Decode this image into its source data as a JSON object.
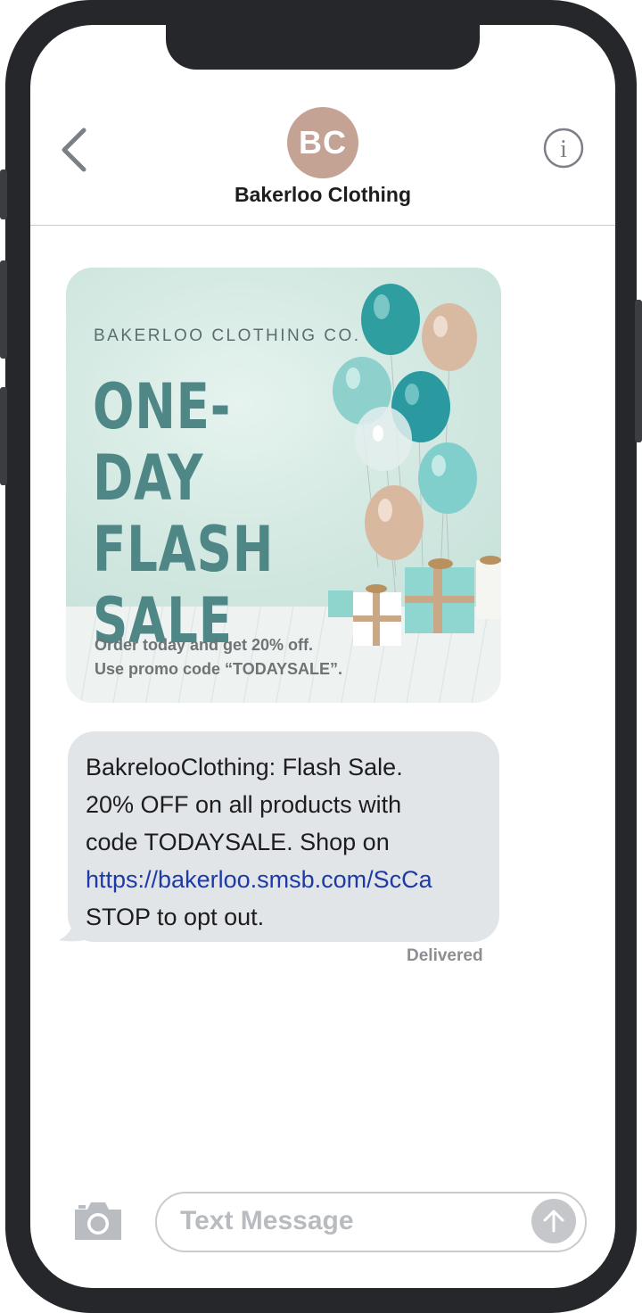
{
  "header": {
    "avatar_initials": "BC",
    "contact_name": "Bakerloo Clothing",
    "back_icon": "chevron-left-icon",
    "info_icon": "info-icon"
  },
  "promo_image": {
    "brand": "BAKERLOO CLOTHING CO.",
    "headline_line1": "ONE-DAY",
    "headline_line2": "FLASH",
    "headline_line3": "SALE",
    "note_line1": "Order today and get 20% off.",
    "note_line2": "Use promo code “TODAYSALE”."
  },
  "message": {
    "line1": "BakrelooClothing: Flash Sale.",
    "line2": "20% OFF on all products with",
    "line3": "code TODAYSALE. Shop on",
    "link": "https://bakerloo.smsb.com/ScCa",
    "line5": "STOP to opt out.",
    "status": "Delivered"
  },
  "composer": {
    "placeholder": "Text Message",
    "camera_icon": "camera-icon",
    "send_icon": "arrow-up-icon"
  },
  "colors": {
    "avatar": "#c4a394",
    "bubble": "#e2e5e8",
    "link": "#1d3aa6",
    "headline": "#4f8787",
    "frame": "#25272b"
  }
}
